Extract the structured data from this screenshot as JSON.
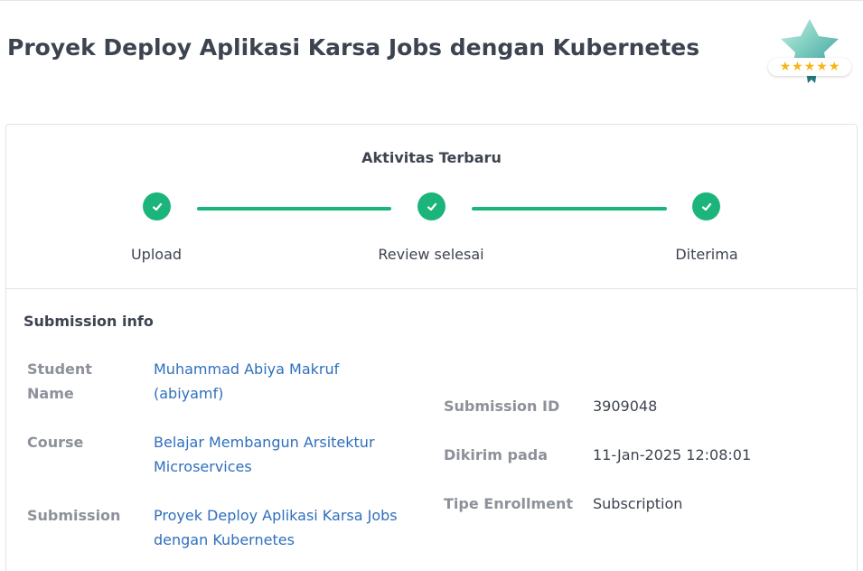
{
  "page": {
    "title": "Proyek Deploy Aplikasi Karsa Jobs dengan Kubernetes"
  },
  "rating": {
    "stars": 5,
    "star_glyphs": [
      "★",
      "★",
      "★",
      "★",
      "★"
    ],
    "star_color": "#f7b617"
  },
  "activity": {
    "title": "Aktivitas Terbaru",
    "accent_color": "#1bb57b",
    "steps": [
      {
        "label": "Upload",
        "status": "done",
        "icon": "check-icon"
      },
      {
        "label": "Review selesai",
        "status": "done",
        "icon": "check-icon"
      },
      {
        "label": "Diterima",
        "status": "done",
        "icon": "check-icon"
      }
    ]
  },
  "submission_info": {
    "title": "Submission info",
    "left": [
      {
        "label": "Student Name",
        "value": "Muhammad Abiya Makruf (abiyamf)",
        "link": true
      },
      {
        "label": "Course",
        "value": "Belajar Membangun Arsitektur Microservices",
        "link": true
      },
      {
        "label": "Submission",
        "value": "Proyek Deploy Aplikasi Karsa Jobs dengan Kubernetes",
        "link": true
      }
    ],
    "right": [
      {
        "label": "Submission ID",
        "value": "3909048"
      },
      {
        "label": "Dikirim pada",
        "value": "11-Jan-2025 12:08:01"
      },
      {
        "label": "Tipe Enrollment",
        "value": "Subscription"
      }
    ],
    "link_color": "#2f6fbd"
  }
}
